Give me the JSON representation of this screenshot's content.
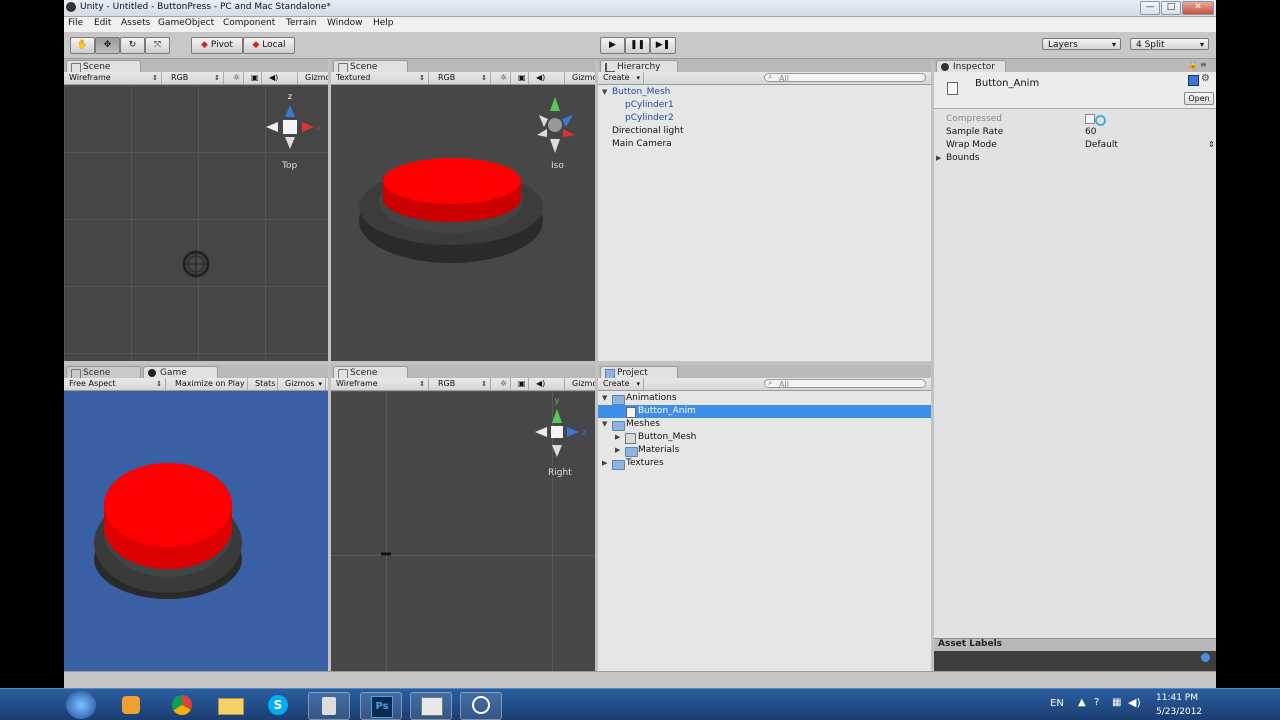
{
  "window": {
    "title": "Unity - Untitled - ButtonPress - PC and Mac Standalone*",
    "minimize": "—",
    "maximize": "□",
    "close": "✕"
  },
  "menu": [
    "File",
    "Edit",
    "Assets",
    "GameObject",
    "Component",
    "Terrain",
    "Window",
    "Help"
  ],
  "toolbar": {
    "pivot": "Pivot",
    "local": "Local",
    "layers": "Layers",
    "layout": "4 Split"
  },
  "views": {
    "top_left": {
      "tab": "Scene",
      "mode": "Wireframe",
      "channel": "RGB",
      "gizmos": "Gizmo",
      "label": "Top"
    },
    "top_right": {
      "tab": "Scene",
      "mode": "Textured",
      "channel": "RGB",
      "gizmos": "Gizmo",
      "label": "Iso"
    },
    "bottom_left": {
      "tab_scene": "Scene",
      "tab_game": "Game",
      "aspect": "Free Aspect",
      "maximize": "Maximize on Play",
      "stats": "Stats",
      "gizmos": "Gizmos"
    },
    "bottom_right": {
      "tab": "Scene",
      "mode": "Wireframe",
      "channel": "RGB",
      "gizmos": "Gizmo",
      "label": "Right"
    }
  },
  "hierarchy": {
    "tab": "Hierarchy",
    "create": "Create",
    "search_placeholder": "All",
    "items": [
      "Button_Mesh",
      "pCylinder1",
      "pCylinder2",
      "Directional light",
      "Main Camera"
    ]
  },
  "project": {
    "tab": "Project",
    "create": "Create",
    "search_placeholder": "All",
    "items": [
      "Animations",
      "Button_Anim",
      "Meshes",
      "Button_Mesh",
      "Materials",
      "Textures"
    ]
  },
  "inspector": {
    "tab": "Inspector",
    "asset_name": "Button_Anim",
    "open": "Open",
    "compressed_label": "Compressed",
    "sample_rate_label": "Sample Rate",
    "sample_rate_value": "60",
    "wrap_mode_label": "Wrap Mode",
    "wrap_mode_value": "Default",
    "bounds_label": "Bounds",
    "asset_labels": "Asset Labels"
  },
  "taskbar": {
    "language": "EN",
    "time": "11:41 PM",
    "date": "5/23/2012"
  },
  "colors": {
    "button_red": "#ff0000",
    "game_bg": "#3a5fa5",
    "selection": "#3d8ee6"
  }
}
